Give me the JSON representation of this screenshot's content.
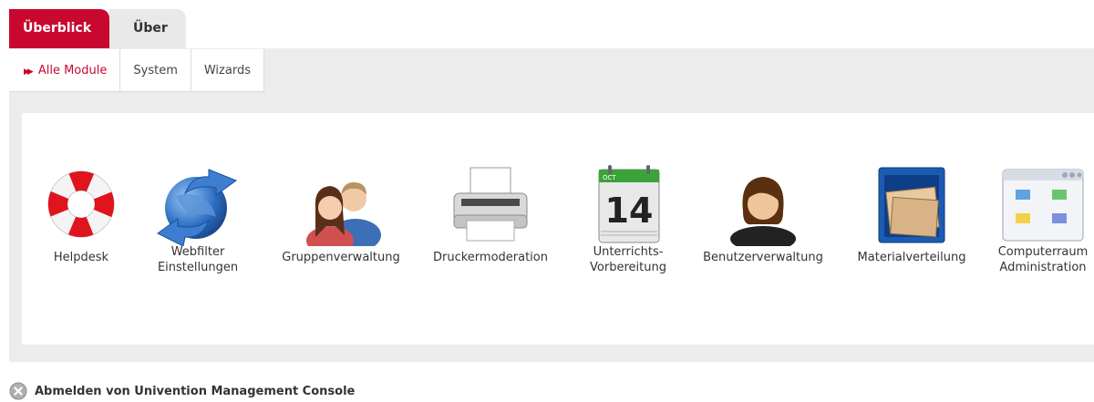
{
  "tabs": [
    {
      "label": "Überblick",
      "active": true
    },
    {
      "label": "Über",
      "active": false
    }
  ],
  "subnav": [
    {
      "label": "Alle Module",
      "active": true
    },
    {
      "label": "System",
      "active": false
    },
    {
      "label": "Wizards",
      "active": false
    }
  ],
  "modules": [
    {
      "line1": "Helpdesk",
      "line2": "",
      "icon": "lifebuoy-icon"
    },
    {
      "line1": "Webfilter",
      "line2": "Einstellungen",
      "icon": "globe-arrows-icon"
    },
    {
      "line1": "Gruppenverwaltung",
      "line2": "",
      "icon": "group-people-icon"
    },
    {
      "line1": "Druckermoderation",
      "line2": "",
      "icon": "printer-icon"
    },
    {
      "line1": "Unterrichts-",
      "line2": "Vorbereitung",
      "icon": "calendar-icon"
    },
    {
      "line1": "Benutzerverwaltung",
      "line2": "",
      "icon": "user-icon"
    },
    {
      "line1": "Materialverteilung",
      "line2": "",
      "icon": "file-cabinet-icon"
    },
    {
      "line1": "Computerraum",
      "line2": "Administration",
      "icon": "computer-room-window-icon"
    }
  ],
  "calendar": {
    "month": "OCT",
    "day": "14"
  },
  "logout": {
    "label": "Abmelden von Univention Management Console"
  },
  "colors": {
    "accent": "#c8082f",
    "panel": "#ececec"
  }
}
